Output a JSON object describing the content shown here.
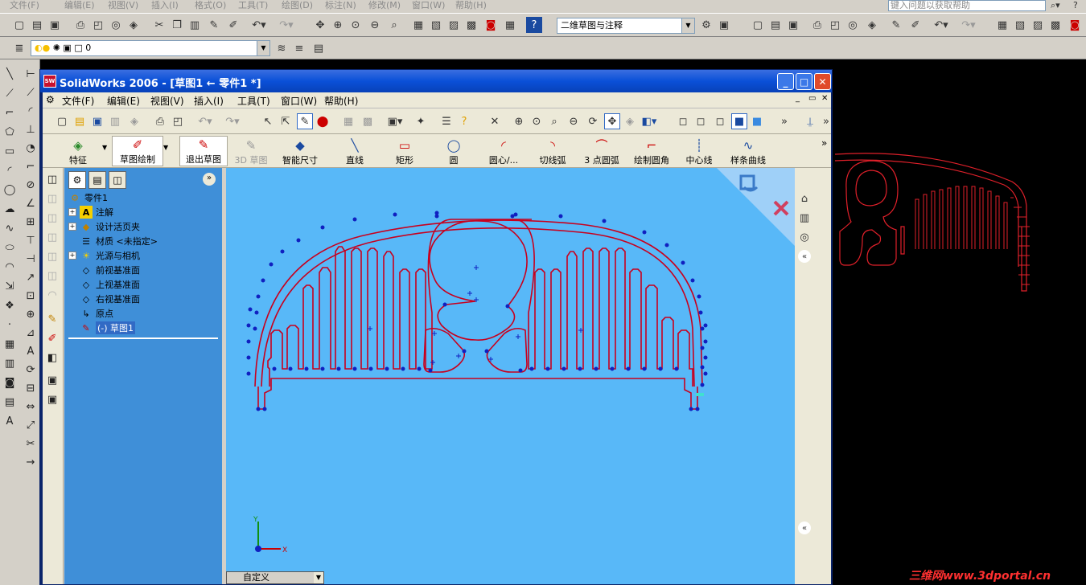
{
  "acad": {
    "menu": [
      "文件(F)",
      "编辑(E)",
      "视图(V)",
      "插入(I)",
      "格式(O)",
      "工具(T)",
      "绘图(D)",
      "标注(N)",
      "修改(M)",
      "窗口(W)",
      "帮助(H)"
    ],
    "help_search": "键入问题以获取帮助",
    "workspace": "二维草图与注释",
    "layer": "0"
  },
  "sw": {
    "title": "SolidWorks 2006 - [草图1 ← 零件1 *]",
    "menu": [
      "文件(F)",
      "编辑(E)",
      "视图(V)",
      "插入(I)",
      "工具(T)",
      "窗口(W)",
      "帮助(H)"
    ],
    "command_manager": [
      "特征",
      "草图绘制",
      "退出草图",
      "3D 草图",
      "智能尺寸",
      "直线",
      "矩形",
      "圆",
      "圆心/...",
      "切线弧",
      "3 点圆弧",
      "绘制圆角",
      "中心线",
      "样条曲线"
    ],
    "tree": {
      "root": "零件1",
      "items": [
        "注解",
        "设计活页夹",
        "材质 <未指定>",
        "光源与相机",
        "前视基准面",
        "上视基准面",
        "右视基准面",
        "原点",
        "(-) 草图1"
      ]
    },
    "view_combo": "自定义",
    "triad": {
      "x": "X",
      "y": "Y"
    }
  },
  "watermark": "三维网www.3dportal.cn",
  "colors": {
    "sketch": "#c8001e",
    "point": "#1020c0",
    "viewport": "#58b8f8",
    "titlebar": "#0a50d8"
  }
}
